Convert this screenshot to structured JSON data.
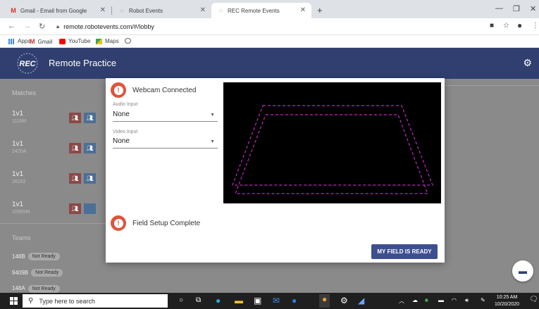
{
  "browser": {
    "tabs": [
      {
        "label": "Gmail - Email from Google",
        "icon": "gmail-icon"
      },
      {
        "label": "Robot Events",
        "icon": "robotevents-icon"
      },
      {
        "label": "REC Remote Events",
        "icon": "robotevents-icon",
        "active": true
      }
    ],
    "new_tab": "+",
    "url": "remote.robotevents.com/#/lobby",
    "bookmarks": [
      {
        "label": "Apps",
        "icon": "apps-grid-icon"
      },
      {
        "label": "Gmail",
        "icon": "gmail-icon"
      },
      {
        "label": "YouTube",
        "icon": "youtube-icon"
      },
      {
        "label": "Maps",
        "icon": "maps-icon"
      },
      {
        "label": "",
        "icon": "globe-icon"
      }
    ]
  },
  "app": {
    "title": "Remote Practice",
    "logo_text": "REC"
  },
  "sidebar": {
    "matches_header": "Matches",
    "matches": [
      {
        "label": "1v1",
        "id": "1116M"
      },
      {
        "label": "1v1",
        "id": "2420A"
      },
      {
        "label": "1v1",
        "id": "26162"
      },
      {
        "label": "1v1",
        "id": "10955M"
      }
    ],
    "teams_header": "Teams",
    "teams": [
      {
        "name": "148B",
        "status": "Not Ready"
      },
      {
        "name": "9409B",
        "status": "Not Ready"
      },
      {
        "name": "148A",
        "status": "Not Ready"
      }
    ]
  },
  "dialog": {
    "webcam_title": "Webcam Connected",
    "audio_label": "Audio Input",
    "audio_value": "None",
    "video_label": "Video Input",
    "video_value": "None",
    "field_title": "Field Setup Complete",
    "ready_button": "MY FIELD IS READY"
  },
  "taskbar": {
    "search_placeholder": "Type here to search",
    "time": "10:25 AM",
    "date": "10/20/2020"
  },
  "colors": {
    "header": "#303f6f",
    "warning": "#e0533a",
    "button": "#3e4f8f",
    "overlay": "#8a8a8a",
    "frame": "#c027c0"
  }
}
